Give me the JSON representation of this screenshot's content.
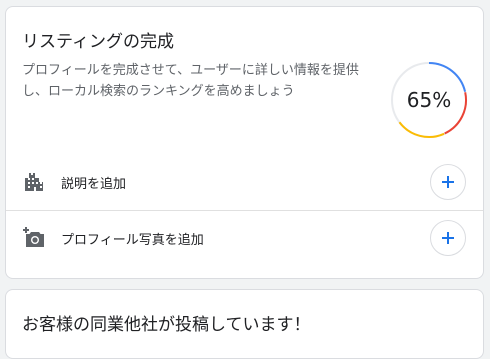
{
  "listing_card": {
    "title": "リスティングの完成",
    "description": "プロフィールを完成させて、ユーザーに詳しい情報を提供し、ローカル検索のランキングを高めましょう",
    "progress": {
      "value": 65,
      "label": "65%",
      "colors": [
        "#4285f4",
        "#ea4335",
        "#fbbc04"
      ]
    },
    "tasks": [
      {
        "label": "説明を追加",
        "icon": "building-icon",
        "action": "add"
      },
      {
        "label": "プロフィール写真を追加",
        "icon": "add-photo-icon",
        "action": "add"
      }
    ]
  },
  "peers_card": {
    "title": "お客様の同業他社が投稿しています！"
  },
  "accent_color": "#1a73e8"
}
